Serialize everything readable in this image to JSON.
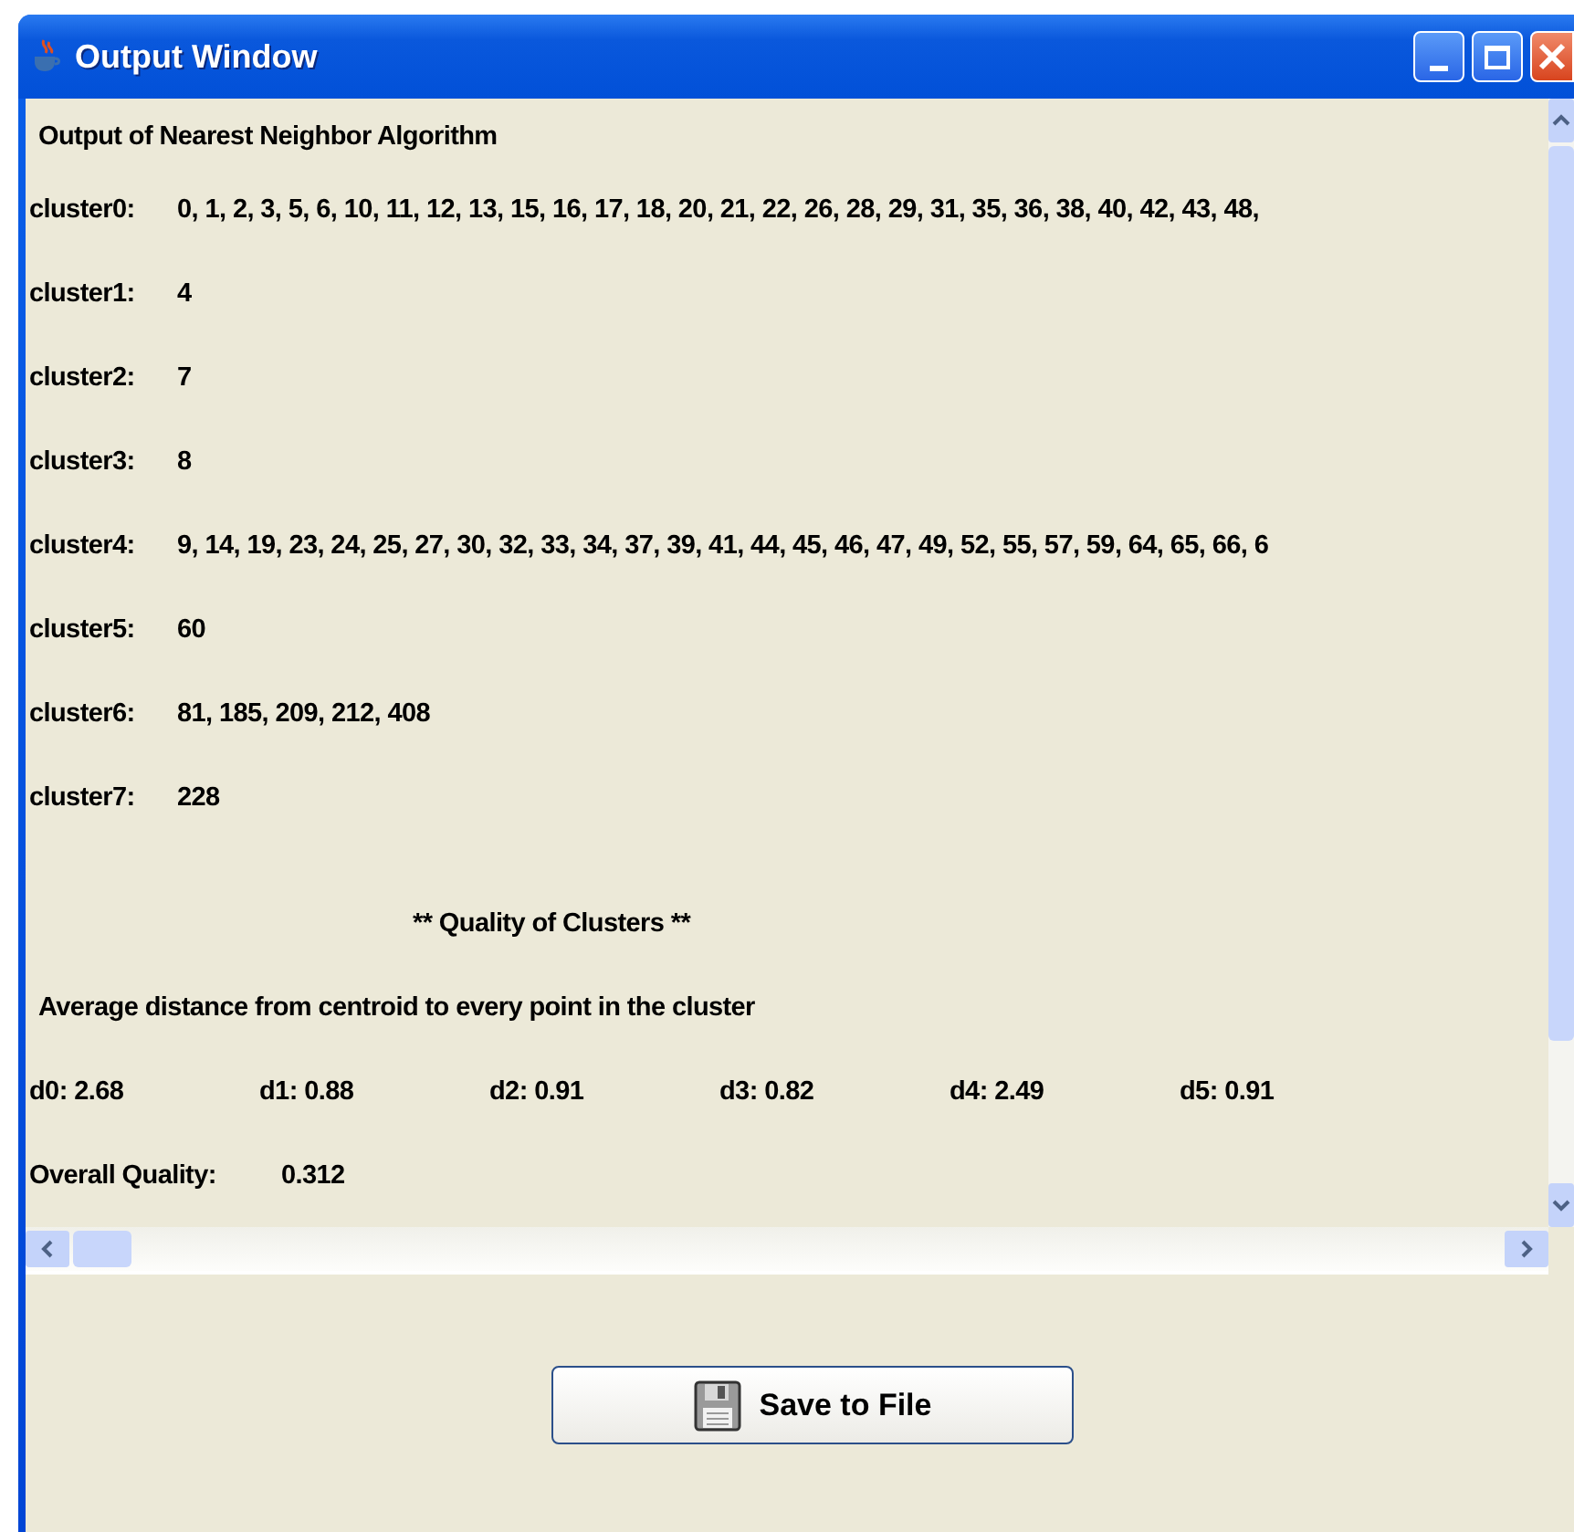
{
  "window": {
    "title": "Output Window"
  },
  "output": {
    "heading": "Output of Nearest Neighbor Algorithm",
    "clusters": [
      {
        "label": "cluster0:",
        "members": "0, 1, 2, 3, 5, 6, 10, 11, 12, 13, 15, 16, 17, 18, 20, 21, 22, 26, 28, 29, 31, 35, 36, 38, 40, 42, 43, 48,"
      },
      {
        "label": "cluster1:",
        "members": "4"
      },
      {
        "label": "cluster2:",
        "members": "7"
      },
      {
        "label": "cluster3:",
        "members": "8"
      },
      {
        "label": "cluster4:",
        "members": "9, 14, 19, 23, 24, 25, 27, 30, 32, 33, 34, 37, 39, 41, 44, 45, 46, 47, 49, 52, 55, 57, 59, 64, 65, 66, 6"
      },
      {
        "label": "cluster5:",
        "members": "60"
      },
      {
        "label": "cluster6:",
        "members": "81, 185, 209, 212, 408"
      },
      {
        "label": "cluster7:",
        "members": "228"
      }
    ],
    "quality_heading": "** Quality of Clusters **",
    "distance_caption": "Average distance from centroid to every point in the cluster",
    "distances": [
      "d0: 2.68",
      "d1: 0.88",
      "d2: 0.91",
      "d3: 0.82",
      "d4: 2.49",
      "d5: 0.91"
    ],
    "overall_label": "Overall Quality:",
    "overall_value": "0.312"
  },
  "buttons": [
    {
      "label": "Save to File",
      "kind": "save"
    }
  ]
}
